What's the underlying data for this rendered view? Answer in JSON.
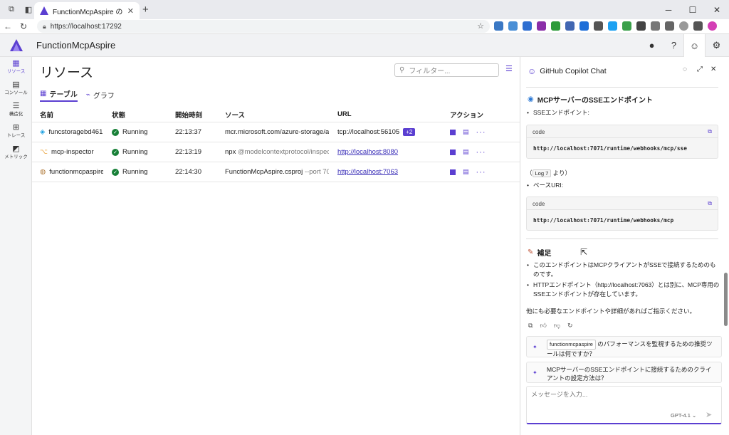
{
  "browser": {
    "tab_title": "FunctionMcpAspire のリソース",
    "url": "https://localhost:17292",
    "new_tab": "+",
    "close": "✕",
    "window_controls": [
      "─",
      "☐",
      "✕"
    ]
  },
  "app": {
    "name": "FunctionMcpAspire",
    "brand_color": "#5b3fd1"
  },
  "leftnav": [
    {
      "label": "リソース",
      "icon": "grid-icon",
      "glyph": "▦",
      "active": true
    },
    {
      "label": "コンソール",
      "icon": "console-icon",
      "glyph": "▤",
      "active": false
    },
    {
      "label": "構造化",
      "icon": "structured-icon",
      "glyph": "☰",
      "active": false
    },
    {
      "label": "トレース",
      "icon": "trace-icon",
      "glyph": "⊞",
      "active": false
    },
    {
      "label": "メトリック",
      "icon": "metrics-icon",
      "glyph": "◩",
      "active": false
    }
  ],
  "main": {
    "title": "リソース",
    "filter_placeholder": "フィルター...",
    "views": [
      {
        "label": "テーブル",
        "icon": "table-icon",
        "glyph": "▦",
        "active": true
      },
      {
        "label": "グラフ",
        "icon": "graph-icon",
        "glyph": "⌁",
        "active": false
      }
    ],
    "columns": [
      "名前",
      "状態",
      "開始時刻",
      "ソース",
      "URL",
      "アクション"
    ],
    "rows": [
      {
        "name": "funcstoragebd461",
        "icon_color": "#1ba1e2",
        "icon_glyph": "◈",
        "state": "Running",
        "start": "22:13:37",
        "source": "mcr.microsoft.com/azure-storage/az...",
        "source_extra": "",
        "url": "tcp://localhost:56105",
        "url_is_link": false,
        "url_badge": "+2"
      },
      {
        "name": "mcp-inspector",
        "icon_color": "#e8a33d",
        "icon_glyph": "⌥",
        "state": "Running",
        "start": "22:13:19",
        "source": "npx",
        "source_extra": "@modelcontextprotocol/inspec...",
        "url": "http://localhost:8080",
        "url_is_link": true,
        "url_badge": ""
      },
      {
        "name": "functionmcpaspire",
        "icon_color": "#b07a3a",
        "icon_glyph": "◍",
        "state": "Running",
        "start": "22:14:30",
        "source": "FunctionMcpAspire.csproj",
        "source_extra": "--port 7063",
        "url": "http://localhost:7063",
        "url_is_link": true,
        "url_badge": ""
      }
    ]
  },
  "chat": {
    "title": "GitHub Copilot Chat",
    "section1_title": "MCPサーバーのSSEエンドポイント",
    "bullet1": "SSEエンドポイント:",
    "code_label": "code",
    "code1": "http://localhost:7071/runtime/webhooks/mcp/sse",
    "ref_prefix": "（",
    "ref_tag": "Log 7",
    "ref_suffix": "より）",
    "bullet2": "ベースURI:",
    "code2": "http://localhost:7071/runtime/webhooks/mcp",
    "section2_title": "補足",
    "note1": "このエンドポイントはMCPクライアントがSSEで接続するためのものです。",
    "note2": "HTTPエンドポイント（http://localhost:7063）とは別に、MCP専用のSSEエンドポイントが存在しています。",
    "closing": "他にも必要なエンドポイントや詳細があればご指示ください。",
    "suggestion1_tag": "functionmcpaspire",
    "suggestion1_text": "のパフォーマンスを監視するための推奨ツールは何ですか？",
    "suggestion2_text": "MCPサーバーのSSEエンドポイントに接続するためのクライアントの設定方法は？",
    "input_placeholder": "メッセージを入力...",
    "model": "GPT-4.1 ⌄"
  }
}
